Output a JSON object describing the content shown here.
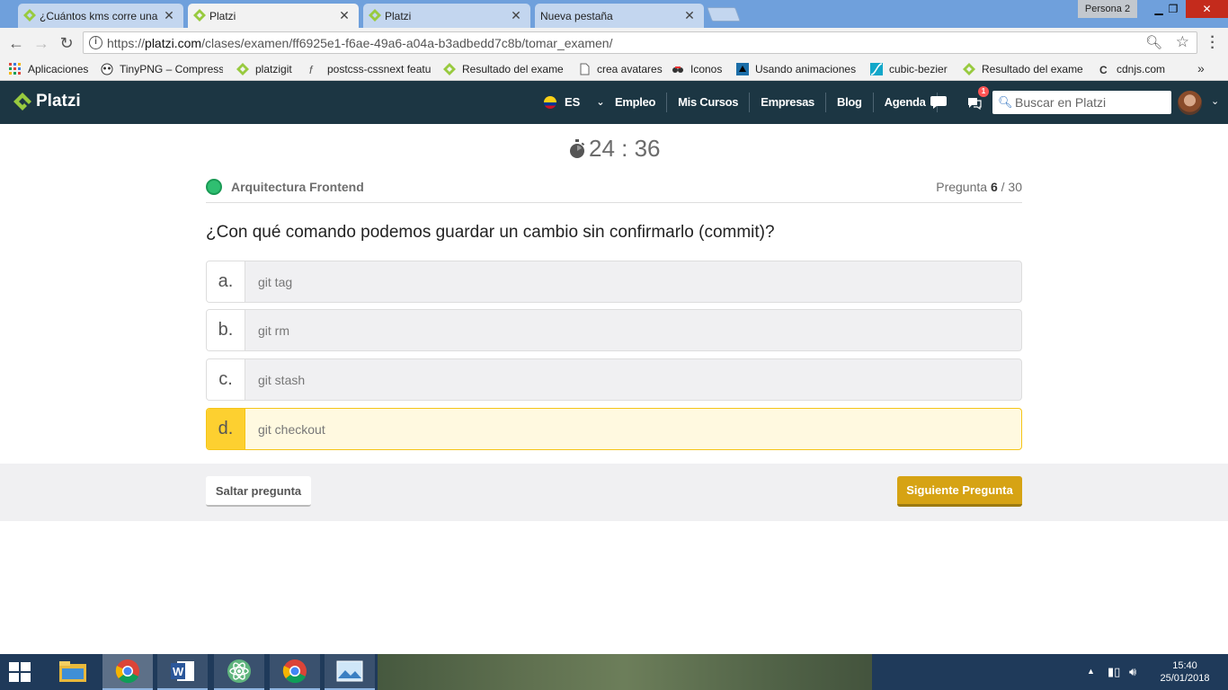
{
  "browser": {
    "tabs": [
      {
        "title": "¿Cuántos kms corre una",
        "active": false
      },
      {
        "title": "Platzi",
        "active": true
      },
      {
        "title": "Platzi",
        "active": false
      },
      {
        "title": "Nueva pestaña",
        "active": false
      }
    ],
    "profile": "Persona 2",
    "url_scheme": "https://",
    "url_host": "platzi.com",
    "url_path": "/clases/examen/ff6925e1-f6ae-49a6-a04a-b3adbedd7c8b/tomar_examen/"
  },
  "bookmarks": [
    {
      "label": "Aplicaciones",
      "icon": "apps-grid-icon"
    },
    {
      "label": "TinyPNG – Compress",
      "icon": "panda-icon"
    },
    {
      "label": "platzigit",
      "icon": "platzi-icon"
    },
    {
      "label": "postcss-cssnext featu",
      "icon": "postcss-icon"
    },
    {
      "label": "Resultado del exame",
      "icon": "platzi-icon"
    },
    {
      "label": "crea avatares",
      "icon": "page-icon"
    },
    {
      "label": "Iconos",
      "icon": "glasses-icon"
    },
    {
      "label": "Usando animaciones",
      "icon": "animation-icon"
    },
    {
      "label": "cubic-bezier",
      "icon": "curve-icon"
    },
    {
      "label": "Resultado del exame",
      "icon": "platzi-icon"
    },
    {
      "label": "cdnjs.com",
      "icon": "cdnjs-icon"
    }
  ],
  "header": {
    "logo_text": "Platzi",
    "lang": "ES",
    "nav": [
      "Empleo",
      "Mis Cursos",
      "Empresas",
      "Blog",
      "Agenda"
    ],
    "notifications_count": "1",
    "search_placeholder": "Buscar en Platzi"
  },
  "exam": {
    "timer": "24 : 36",
    "course": "Arquitectura Frontend",
    "question_label": "Pregunta",
    "question_current": "6",
    "question_total": "/ 30",
    "question": "¿Con qué comando podemos guardar un cambio sin confirmarlo (commit)?",
    "options": [
      {
        "letter": "a.",
        "text": "git tag",
        "selected": false
      },
      {
        "letter": "b.",
        "text": "git rm",
        "selected": false
      },
      {
        "letter": "c.",
        "text": "git stash",
        "selected": false
      },
      {
        "letter": "d.",
        "text": "git checkout",
        "selected": true
      }
    ],
    "skip_label": "Saltar pregunta",
    "next_label": "Siguiente Pregunta"
  },
  "colors": {
    "header_bg": "#1c3643",
    "accent_yellow": "#fdd030",
    "next_button": "#d6a314",
    "platzi_green": "#98ca3f"
  },
  "taskbar": {
    "apps": [
      "file-explorer-icon",
      "chrome-icon",
      "word-icon",
      "atom-icon",
      "chrome-icon",
      "photos-icon"
    ],
    "time": "15:40",
    "date": "25/01/2018"
  }
}
